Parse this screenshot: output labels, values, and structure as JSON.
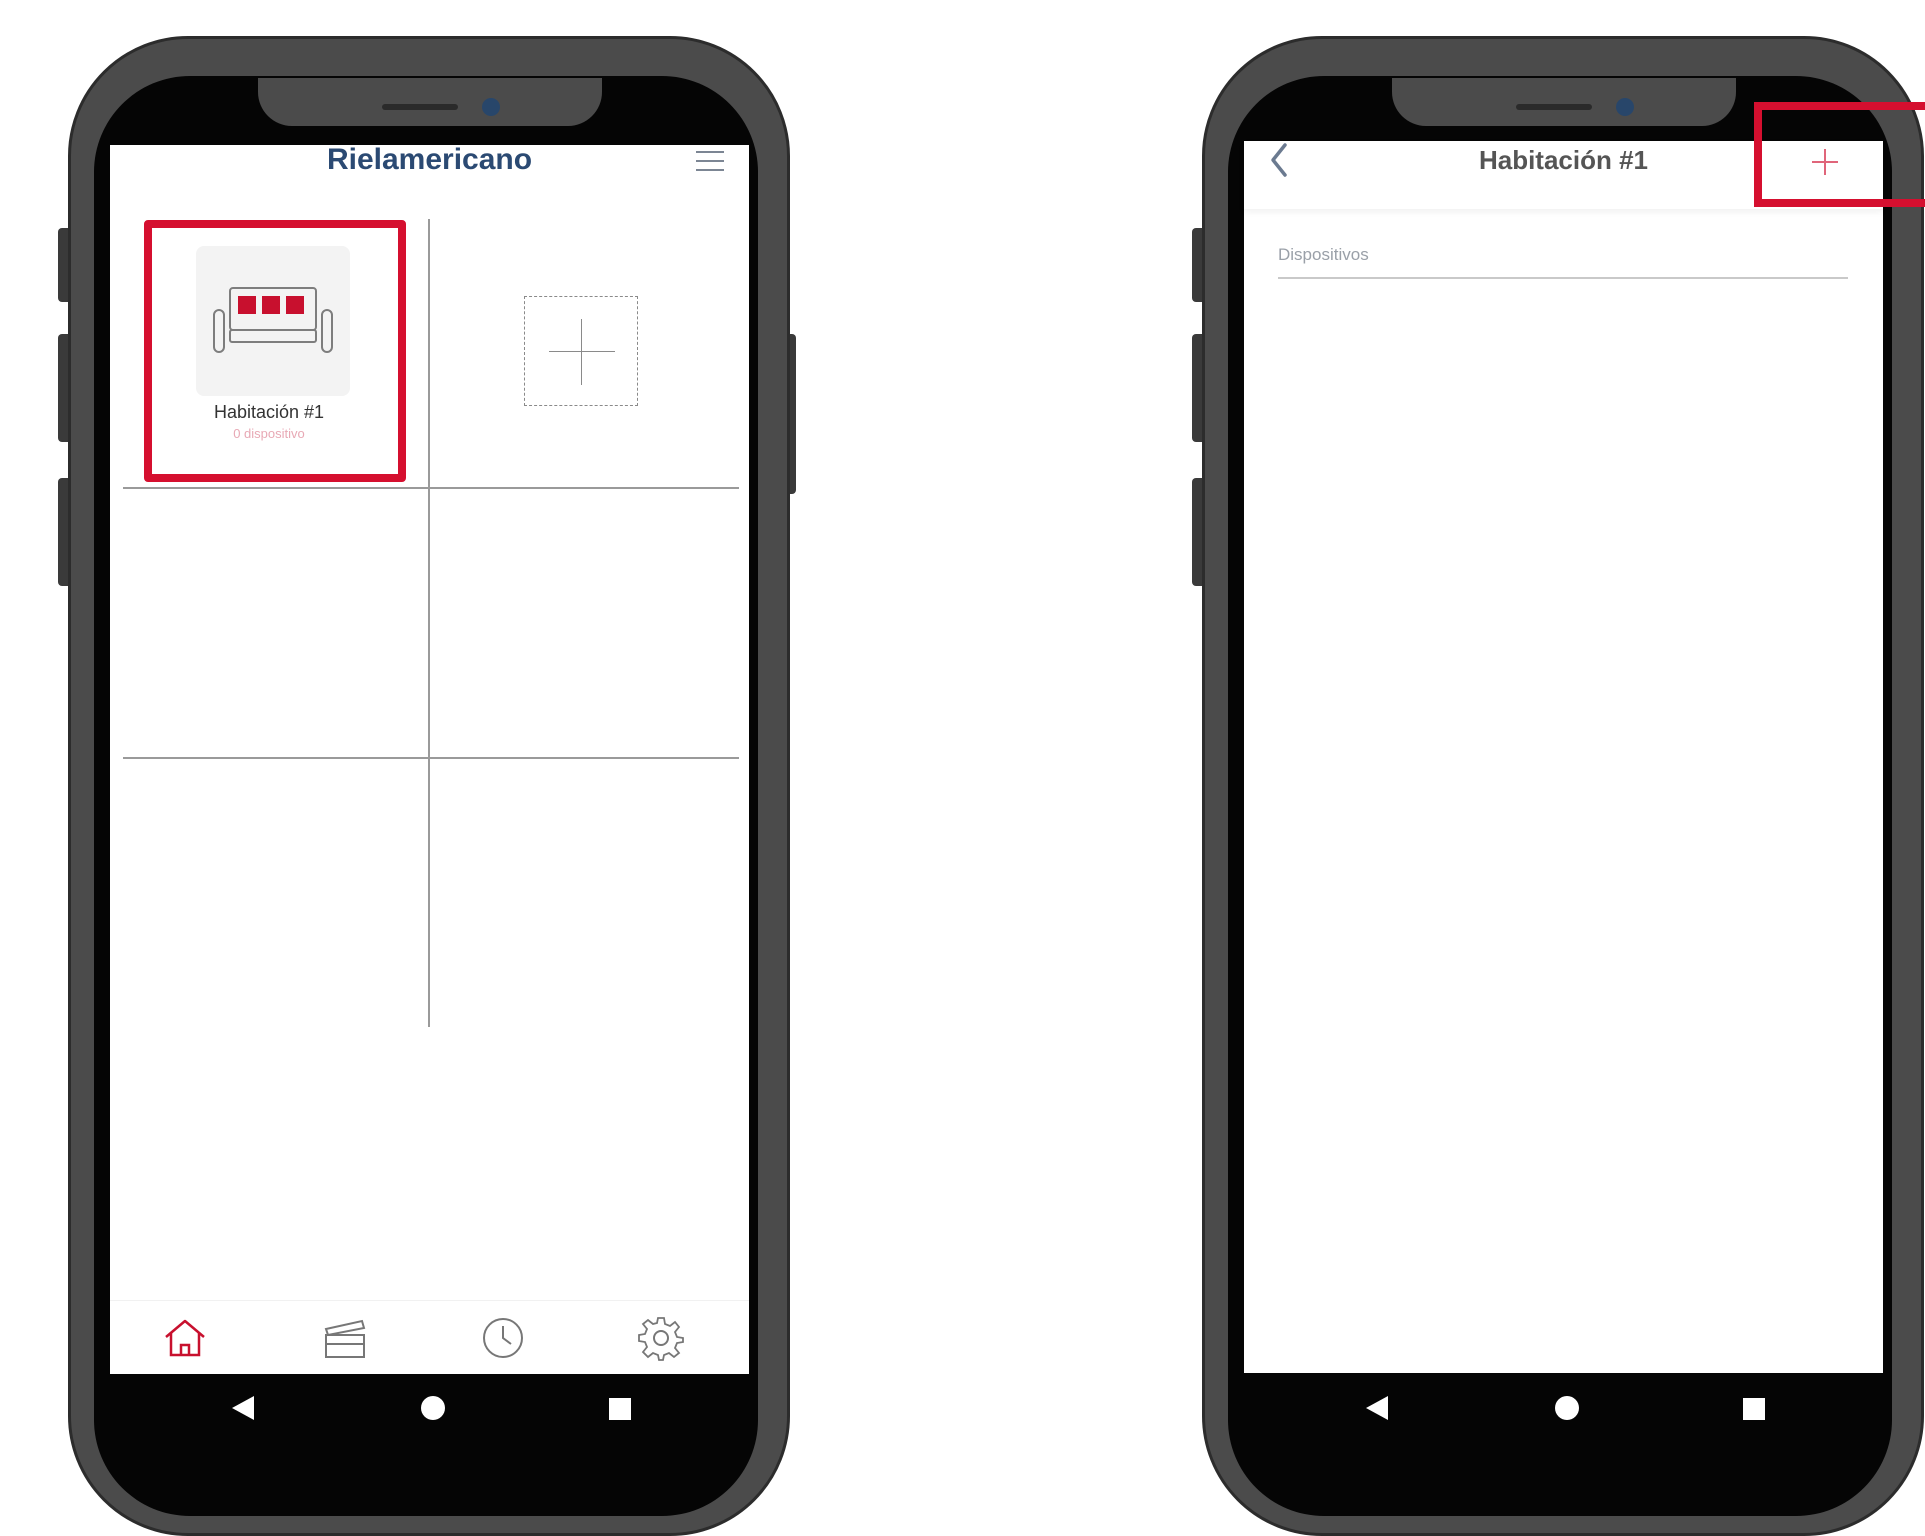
{
  "left_phone": {
    "header": {
      "title": "Rielamericano"
    },
    "room_card": {
      "name": "Habitación #1",
      "device_count": "0 dispositivo"
    },
    "bottom_nav": {
      "items": [
        "home-icon",
        "scenes-icon",
        "clock-icon",
        "gear-icon"
      ],
      "active": "home-icon"
    },
    "system_nav": [
      "back",
      "home",
      "recents"
    ]
  },
  "right_phone": {
    "header": {
      "title": "Habitación #1"
    },
    "section": {
      "label": "Dispositivos"
    },
    "system_nav": [
      "back",
      "home",
      "recents"
    ]
  },
  "colors": {
    "accent": "#d50f2f",
    "title_blue": "#2b4a73",
    "frame": "#4a4a4a",
    "muted": "#9aa0a8"
  }
}
